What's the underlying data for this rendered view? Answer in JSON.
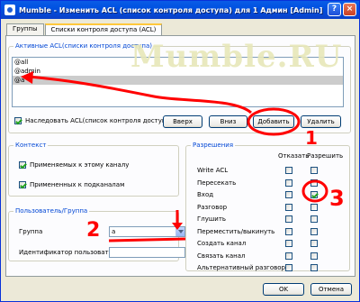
{
  "window": {
    "title": "Mumble - Изменить ACL (список контроля доступа) для 1 Админ [Admin]",
    "help_glyph": "?",
    "close_glyph": "×"
  },
  "tabs": [
    {
      "label": "Группы",
      "active": false
    },
    {
      "label": "Списки контроля доступа (ACL)",
      "active": true
    }
  ],
  "active_acl": {
    "legend": "Активные ACL(списки контроля доступа)",
    "entries": [
      "@all",
      "@admin",
      "@a"
    ],
    "selected_index": 2,
    "inherit_label": "Наследовать ACL(список контроля доступа)",
    "inherit_checked": true,
    "buttons": {
      "up": "Вверх",
      "down": "Вниз",
      "add": "Добавить",
      "remove": "Удалить"
    }
  },
  "context": {
    "legend": "Контекст",
    "apply_here": "Применяемых к этому каналу",
    "apply_here_checked": true,
    "apply_sub": "Примененных к подканалам",
    "apply_sub_checked": true
  },
  "user_group": {
    "legend": "Пользователь/Группа",
    "group_label": "Группа",
    "group_value": "a",
    "user_id_label": "Идентификатор пользователя",
    "user_id_value": ""
  },
  "permissions": {
    "legend": "Разрешения",
    "col_deny": "Отказать",
    "col_allow": "Разрешить",
    "rows": [
      {
        "label": "Write ACL",
        "deny": false,
        "allow": false
      },
      {
        "label": "Пересекать",
        "deny": false,
        "allow": false
      },
      {
        "label": "Вход",
        "deny": false,
        "allow": true
      },
      {
        "label": "Разговор",
        "deny": false,
        "allow": false
      },
      {
        "label": "Глушить",
        "deny": false,
        "allow": false
      },
      {
        "label": "Переместить/выкинуть",
        "deny": false,
        "allow": false
      },
      {
        "label": "Создать канал",
        "deny": false,
        "allow": false
      },
      {
        "label": "Связать канал",
        "deny": false,
        "allow": false
      },
      {
        "label": "Альтернативный разговор",
        "deny": false,
        "allow": false
      }
    ]
  },
  "footer": {
    "ok": "OK",
    "cancel": "Отмена"
  },
  "watermark": "Mumble.RU",
  "annotations": {
    "n1": "1",
    "n2": "2",
    "n3": "3",
    "color": "#ff0000"
  }
}
